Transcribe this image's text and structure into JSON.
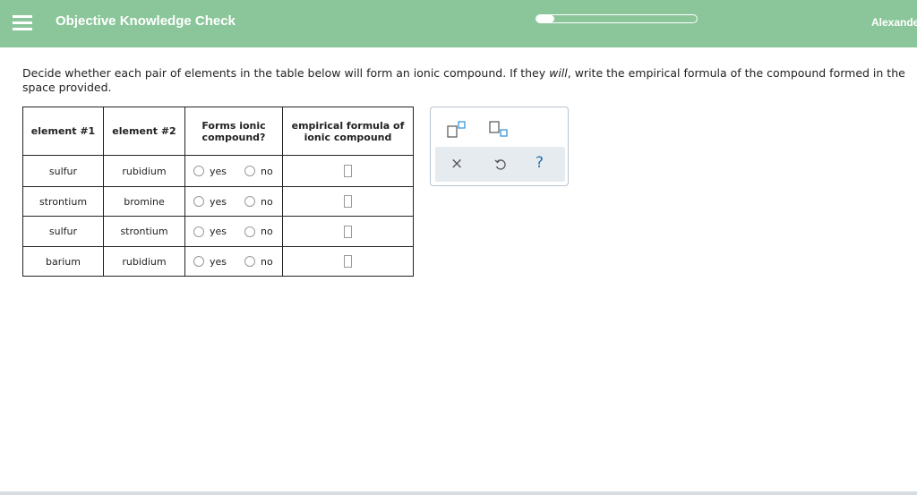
{
  "header": {
    "title": "Objective Knowledge Check",
    "progress_fraction": 0.11,
    "username": "Alexander",
    "colors": {
      "bar": "#8bc69a",
      "text": "#ffffff"
    }
  },
  "instructions": {
    "part1": "Decide whether each pair of elements in the table below will form an ionic compound. If they ",
    "emphasis": "will",
    "part2": ", write the empirical formula of the compound formed in the space provided."
  },
  "table": {
    "headers": {
      "element1": "element #1",
      "element2": "element #2",
      "forms_ionic_line1": "Forms ionic",
      "forms_ionic_line2": "compound?",
      "formula_line1": "empirical formula of",
      "formula_line2": "ionic compound"
    },
    "yes_label": "yes",
    "no_label": "no",
    "rows": [
      {
        "element1": "sulfur",
        "element2": "rubidium"
      },
      {
        "element1": "strontium",
        "element2": "bromine"
      },
      {
        "element1": "sulfur",
        "element2": "strontium"
      },
      {
        "element1": "barium",
        "element2": "rubidium"
      }
    ]
  },
  "palette": {
    "tools": [
      "superscript-icon",
      "subscript-icon",
      "clear-icon",
      "undo-icon",
      "help-icon"
    ],
    "help_glyph": "?",
    "clear_glyph": "×"
  }
}
